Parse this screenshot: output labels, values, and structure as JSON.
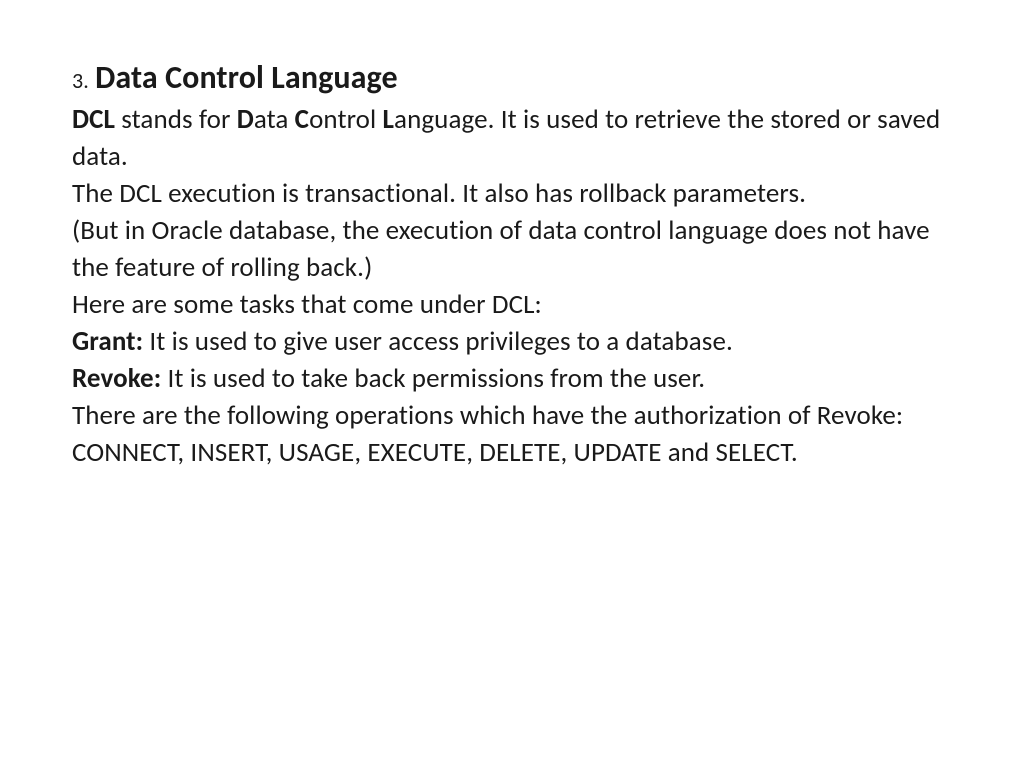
{
  "heading": {
    "number": "3.",
    "title": "Data Control Language"
  },
  "lines": {
    "l1": {
      "b1": "DCL",
      "t1": " stands for ",
      "b2": "D",
      "t2": "ata ",
      "b3": "C",
      "t3": "ontrol ",
      "b4": "L",
      "t4": "anguage. It is used to retrieve the stored or saved data."
    },
    "l2": "The DCL execution is transactional. It also has rollback parameters.",
    "l3": "(But in Oracle database, the execution of data control language does not have the feature of rolling back.)",
    "l4": "Here are some tasks that come under DCL:",
    "l5": {
      "b": "Grant:",
      "t": " It is used to give user access privileges to a database."
    },
    "l6": {
      "b": "Revoke:",
      "t": " It is used to take back permissions from the user."
    },
    "l7": "There are the following operations which have the authorization of Revoke:",
    "l8": "CONNECT, INSERT, USAGE, EXECUTE, DELETE, UPDATE and SELECT."
  }
}
